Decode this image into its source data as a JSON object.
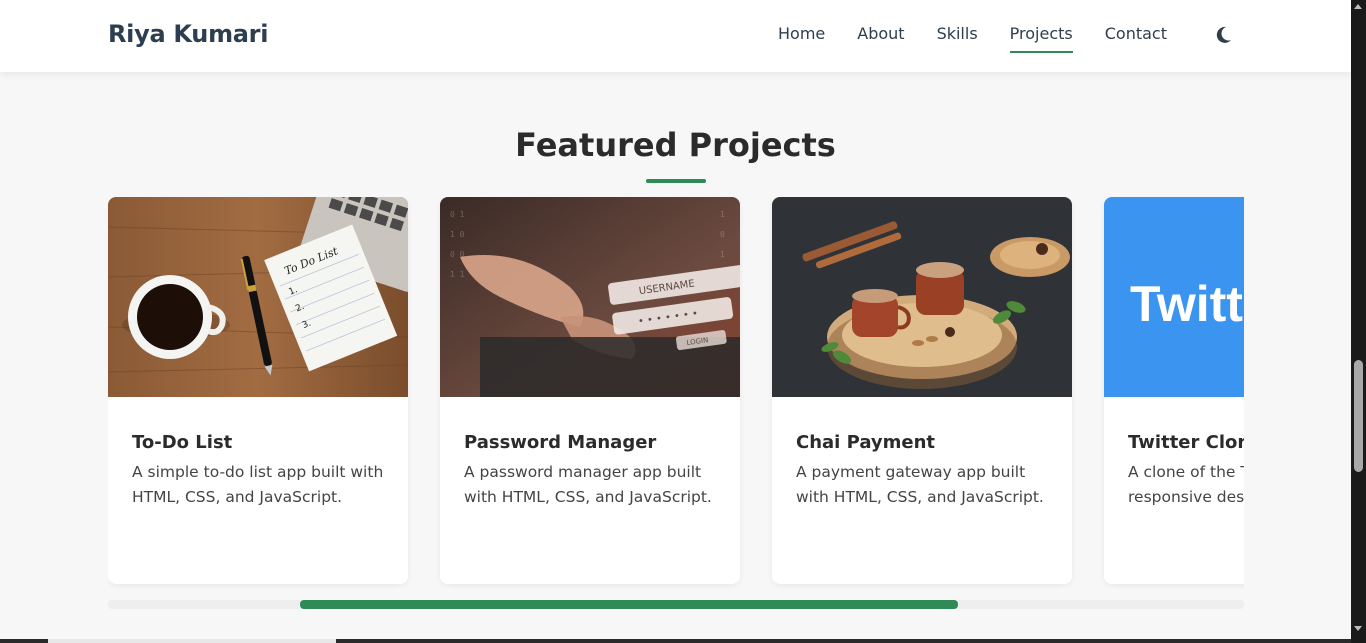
{
  "nav": {
    "brand": "Riya Kumari",
    "links": [
      {
        "label": "Home"
      },
      {
        "label": "About"
      },
      {
        "label": "Skills"
      },
      {
        "label": "Projects",
        "active": true
      },
      {
        "label": "Contact"
      }
    ],
    "theme_icon": "moon-icon"
  },
  "section": {
    "title": "Featured Projects"
  },
  "projects": [
    {
      "title": "To-Do List",
      "description": "A simple to-do list app built with HTML, CSS, and JavaScript.",
      "image": "todo-list-photo"
    },
    {
      "title": "Password Manager",
      "description": "A password manager app built with HTML, CSS, and JavaScript.",
      "image": "login-keyboard-photo"
    },
    {
      "title": "Chai Payment",
      "description": "A payment gateway app built with HTML, CSS, and JavaScript.",
      "image": "chai-cups-photo"
    },
    {
      "title": "Twitter Clon",
      "description": "A clone of the T media platforn responsive des media feed.",
      "image": "twitter-logo-banner",
      "image_text": "Twitt"
    }
  ],
  "carousel": {
    "progress_start": 0.169,
    "progress_width": 0.579
  },
  "colors": {
    "accent": "#2e8b57",
    "heading": "#2b2b2b",
    "brand": "#2c3e50",
    "twitter_blue": "#3b94f0"
  }
}
